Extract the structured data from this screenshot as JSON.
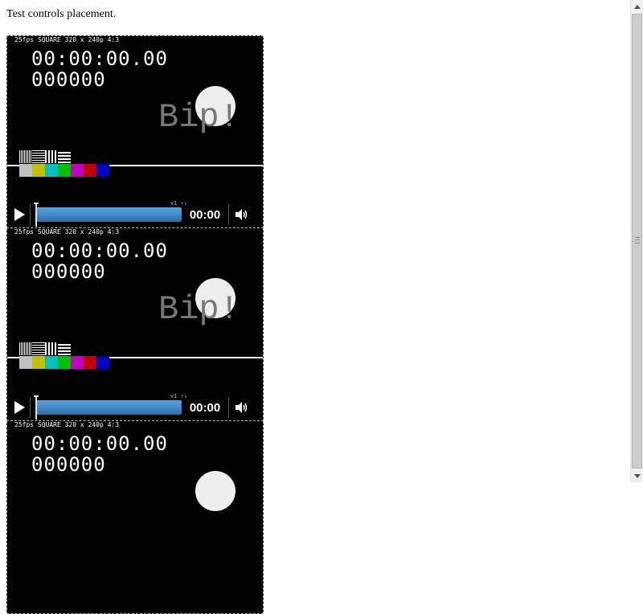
{
  "page": {
    "text": "Test controls placement."
  },
  "videos": [
    {
      "info": "25fps SQUARE 320 x 240p 4:3",
      "timecode": "00:00:00.00",
      "frame": "000000",
      "bip": "Bip!",
      "time_display": "00:00",
      "overlay_label": "v1 ↑↓"
    },
    {
      "info": "25fps SQUARE 320 x 240p 4:3",
      "timecode": "00:00:00.00",
      "frame": "000000",
      "bip": "Bip!",
      "time_display": "00:00",
      "overlay_label": "v1 ↑↓"
    },
    {
      "info": "25fps SQUARE 320 x 240p 4:3",
      "timecode": "00:00:00.00",
      "frame": "000000"
    }
  ],
  "colors": {
    "bars": [
      "#c0c0c0",
      "#c0c000",
      "#00c0c0",
      "#00c000",
      "#c000c0",
      "#c00000",
      "#0000c0"
    ],
    "progress_accent": "#3a80c4"
  },
  "icons": {
    "play": "play-icon",
    "volume": "volume-icon",
    "scroll_up": "arrow-up-icon",
    "scroll_down": "arrow-down-icon"
  }
}
